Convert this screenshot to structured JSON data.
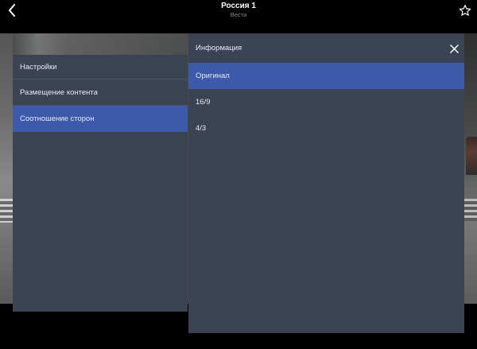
{
  "header": {
    "title": "Россия 1",
    "subtitle": "Вести",
    "back_icon": "chevron-left-icon",
    "favorite_icon": "star-outline-icon"
  },
  "settings": {
    "title": "Настройки",
    "items": [
      {
        "label": "Размещение контента",
        "active": false
      },
      {
        "label": "Соотношение сторон",
        "active": true
      }
    ]
  },
  "info": {
    "title": "Информация",
    "close_icon": "close-icon",
    "options": [
      {
        "label": "Оригинал",
        "selected": true
      },
      {
        "label": "16/9",
        "selected": false
      },
      {
        "label": "4/3",
        "selected": false
      }
    ]
  },
  "colors": {
    "panel_bg": "#3b4251",
    "accent": "#3d59aa",
    "text": "#e8eaee",
    "topbar_bg": "#000000"
  }
}
